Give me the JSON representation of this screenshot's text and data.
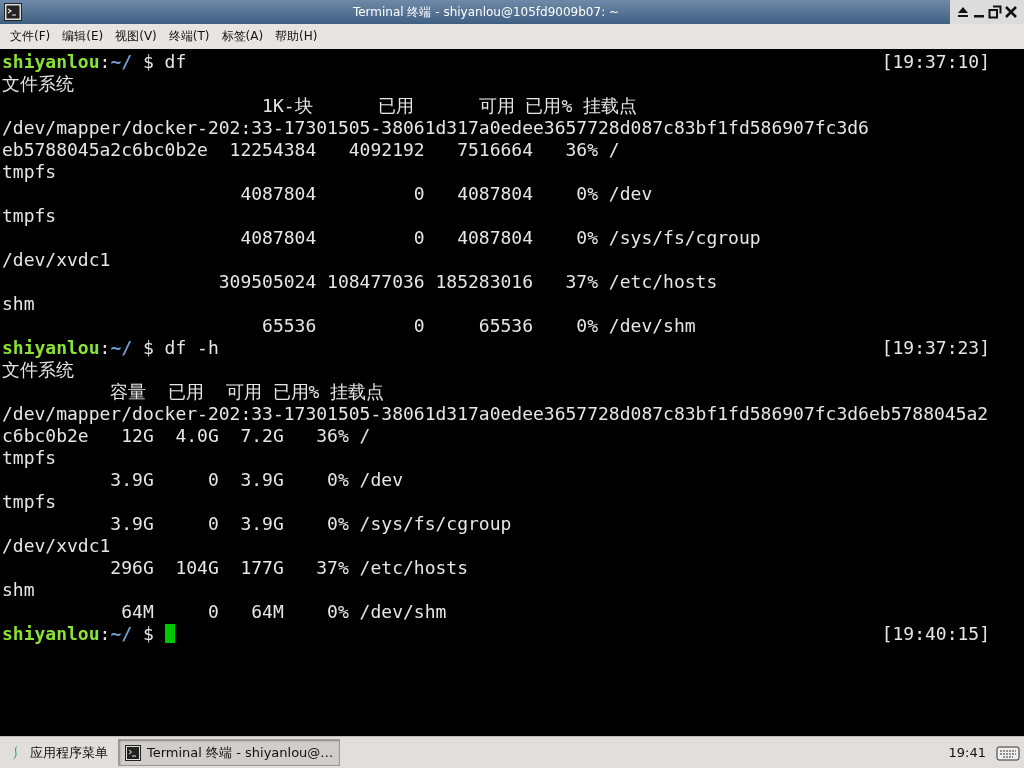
{
  "window": {
    "title": "Terminal 终端 - shiyanlou@105fd9009b07: ~"
  },
  "menu": [
    {
      "label": "文件(F)"
    },
    {
      "label": "编辑(E)"
    },
    {
      "label": "视图(V)"
    },
    {
      "label": "终端(T)"
    },
    {
      "label": "标签(A)"
    },
    {
      "label": "帮助(H)"
    }
  ],
  "terminal": {
    "lines": [
      {
        "kind": "prompt",
        "user": "shiyanlou",
        "separator": ":",
        "path": "~/",
        "command": " $ df",
        "time": "[19:37:10]",
        "cursor": false
      },
      {
        "kind": "output",
        "text": "文件系统"
      },
      {
        "kind": "output",
        "text": "                        1K-块      已用      可用 已用% 挂载点"
      },
      {
        "kind": "output",
        "text": "/dev/mapper/docker-202:33-17301505-38061d317a0edee3657728d087c83bf1fd586907fc3d6"
      },
      {
        "kind": "output",
        "text": "eb5788045a2c6bc0b2e  12254384   4092192   7516664   36% /"
      },
      {
        "kind": "output",
        "text": "tmpfs"
      },
      {
        "kind": "output",
        "text": "                      4087804         0   4087804    0% /dev"
      },
      {
        "kind": "output",
        "text": "tmpfs"
      },
      {
        "kind": "output",
        "text": "                      4087804         0   4087804    0% /sys/fs/cgroup"
      },
      {
        "kind": "output",
        "text": "/dev/xvdc1"
      },
      {
        "kind": "output",
        "text": "                    309505024 108477036 185283016   37% /etc/hosts"
      },
      {
        "kind": "output",
        "text": "shm"
      },
      {
        "kind": "output",
        "text": "                        65536         0     65536    0% /dev/shm"
      },
      {
        "kind": "prompt",
        "user": "shiyanlou",
        "separator": ":",
        "path": "~/",
        "command": " $ df -h",
        "time": "[19:37:23]",
        "cursor": false
      },
      {
        "kind": "output",
        "text": "文件系统"
      },
      {
        "kind": "output",
        "text": "          容量  已用  可用 已用% 挂载点"
      },
      {
        "kind": "output",
        "text": "/dev/mapper/docker-202:33-17301505-38061d317a0edee3657728d087c83bf1fd586907fc3d6eb5788045a2"
      },
      {
        "kind": "output",
        "text": "c6bc0b2e   12G  4.0G  7.2G   36% /"
      },
      {
        "kind": "output",
        "text": "tmpfs"
      },
      {
        "kind": "output",
        "text": "          3.9G     0  3.9G    0% /dev"
      },
      {
        "kind": "output",
        "text": "tmpfs"
      },
      {
        "kind": "output",
        "text": "          3.9G     0  3.9G    0% /sys/fs/cgroup"
      },
      {
        "kind": "output",
        "text": "/dev/xvdc1"
      },
      {
        "kind": "output",
        "text": "          296G  104G  177G   37% /etc/hosts"
      },
      {
        "kind": "output",
        "text": "shm"
      },
      {
        "kind": "output",
        "text": "           64M     0   64M    0% /dev/shm"
      },
      {
        "kind": "prompt",
        "user": "shiyanlou",
        "separator": ":",
        "path": "~/",
        "command": " $ ",
        "time": "[19:40:15]",
        "cursor": true
      }
    ]
  },
  "taskbar": {
    "app_menu": "应用程序菜单",
    "tasks": [
      {
        "label": "Terminal 终端 - shiyanlou@…",
        "selected": true
      }
    ],
    "clock": "19:41"
  }
}
